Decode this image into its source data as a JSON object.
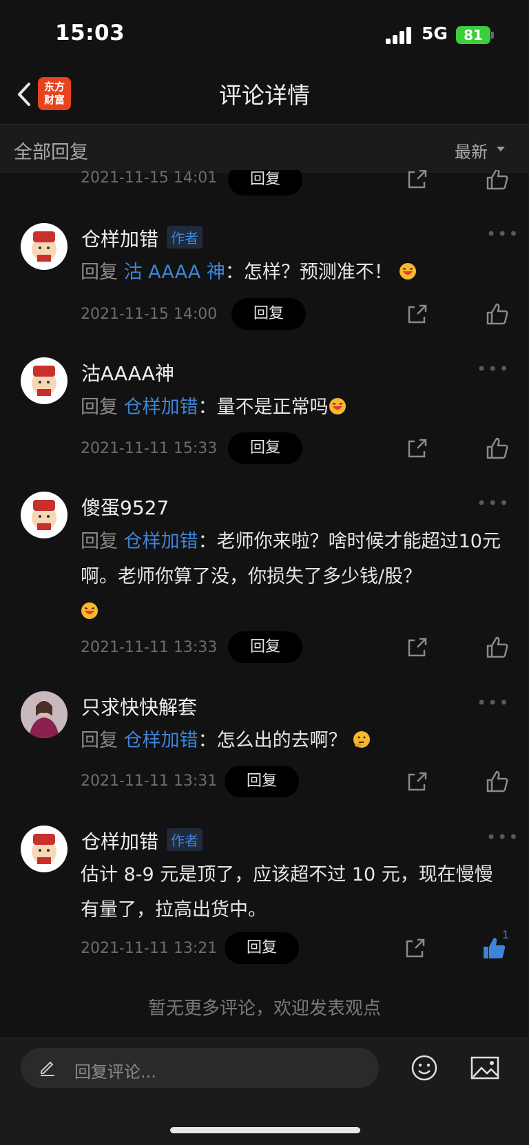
{
  "status": {
    "time": "15:03",
    "network": "5G",
    "battery": "81"
  },
  "nav": {
    "title": "评论详情",
    "logo_line1": "东方",
    "logo_line2": "财富"
  },
  "sub_header": {
    "all_replies": "全部回复",
    "sort": "最新"
  },
  "reply_prefix": "回复",
  "reply_button": "回复",
  "author_badge": "作者",
  "partial": {
    "time": "2021-11-15 14:01"
  },
  "comments": [
    {
      "name": "仓样加错",
      "is_author": true,
      "mention": "沽 AAAA 神",
      "text": "：怎样？预测准不！",
      "time": "2021-11-15 14:00",
      "likes": ""
    },
    {
      "name": "沽AAAA神",
      "is_author": false,
      "mention": "仓样加错",
      "text": "：量不是正常吗",
      "time": "2021-11-11 15:33",
      "likes": ""
    },
    {
      "name": "傻蛋9527",
      "is_author": false,
      "mention": "仓样加错",
      "text": "：老师你来啦？啥时候才能超过10元啊。老师你算了没，你损失了多少钱/股？",
      "time": "2021-11-11 13:33",
      "likes": ""
    },
    {
      "name": "只求快快解套",
      "is_author": false,
      "mention": "仓样加错",
      "text": "：怎么出的去啊？",
      "time": "2021-11-11 13:31",
      "likes": ""
    },
    {
      "name": "仓样加错",
      "is_author": true,
      "text": "估计 8-9 元是顶了，应该超不过 10 元，现在慢慢有量了，拉高出货中。",
      "time": "2021-11-11 13:21",
      "likes": "1"
    }
  ],
  "no_more": "暂无更多评论，欢迎发表观点",
  "input": {
    "placeholder": "回复评论..."
  },
  "colors": {
    "accent": "#3e84d8",
    "logo": "#e8431f",
    "battery": "#3dce3d"
  }
}
